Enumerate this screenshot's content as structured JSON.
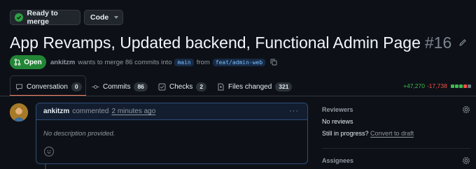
{
  "header": {
    "merge_status_label": "Ready to merge",
    "code_button_label": "Code"
  },
  "pr": {
    "title": "App Revamps, Updated backend, Functional Admin Page",
    "number": "#16",
    "state": "Open",
    "author": "ankitzm",
    "merge_text": "wants to merge 86 commits into",
    "base_branch": "main",
    "from_text": "from",
    "head_branch": "feat/admin-web"
  },
  "tabs": [
    {
      "label": "Conversation",
      "count": "0"
    },
    {
      "label": "Commits",
      "count": "86"
    },
    {
      "label": "Checks",
      "count": "2"
    },
    {
      "label": "Files changed",
      "count": "321"
    }
  ],
  "diffstat": {
    "additions": "+47,270",
    "deletions": "-17,738",
    "blocks": [
      "#3fb950",
      "#3fb950",
      "#3fb950",
      "#f85149",
      "#6e7681"
    ]
  },
  "comment": {
    "author": "ankitzm",
    "action": "commented",
    "time": "2 minutes ago",
    "body": "No description provided.",
    "menu_glyph": "···"
  },
  "sidebar": {
    "reviewers_title": "Reviewers",
    "reviewers_value": "No reviews",
    "in_progress_label": "Still in progress?",
    "convert_link": "Convert to draft",
    "assignees_title": "Assignees"
  },
  "colors": {
    "background": "#0d1117",
    "open_green": "#238636",
    "accent_tab": "#f78166",
    "link_blue": "#79c0ff"
  },
  "icons": [
    "check-circle-icon",
    "chevron-down-icon",
    "pencil-icon",
    "pull-request-icon",
    "copy-icon",
    "comment-icon",
    "commit-icon",
    "checklist-icon",
    "file-diff-icon",
    "gear-icon",
    "kebab-icon",
    "smiley-icon"
  ]
}
